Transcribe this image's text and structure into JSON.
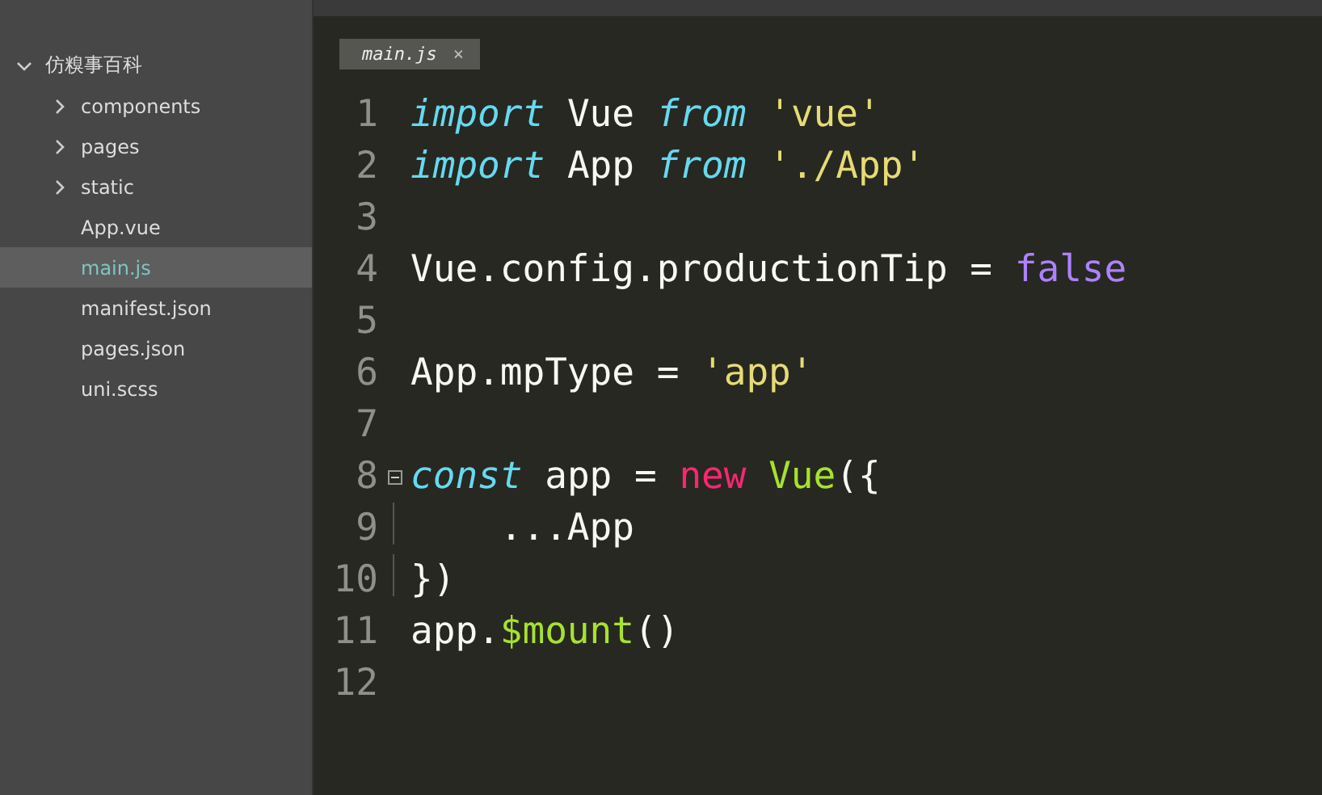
{
  "sidebar": {
    "tree": [
      {
        "label": "仿糗事百科",
        "kind": "folder",
        "expanded": true,
        "selected": false,
        "children": [
          {
            "label": "components",
            "kind": "folder",
            "expanded": false,
            "selected": false
          },
          {
            "label": "pages",
            "kind": "folder",
            "expanded": false,
            "selected": false
          },
          {
            "label": "static",
            "kind": "folder",
            "expanded": false,
            "selected": false
          },
          {
            "label": "App.vue",
            "kind": "file",
            "selected": false
          },
          {
            "label": "main.js",
            "kind": "file",
            "selected": true
          },
          {
            "label": "manifest.json",
            "kind": "file",
            "selected": false
          },
          {
            "label": "pages.json",
            "kind": "file",
            "selected": false
          },
          {
            "label": "uni.scss",
            "kind": "file",
            "selected": false
          }
        ]
      }
    ]
  },
  "tabs": [
    {
      "label": "main.js",
      "close": "×",
      "selected": true
    }
  ],
  "editor": {
    "lines": [
      {
        "number": "1",
        "tokens": [
          {
            "kind": "keyword",
            "text": "import"
          },
          {
            "kind": "plain",
            "text": " Vue "
          },
          {
            "kind": "keyword",
            "text": "from "
          },
          {
            "kind": "string",
            "text": "'vue'"
          }
        ]
      },
      {
        "number": "2",
        "tokens": [
          {
            "kind": "keyword",
            "text": "import"
          },
          {
            "kind": "plain",
            "text": " App "
          },
          {
            "kind": "keyword",
            "text": "from "
          },
          {
            "kind": "string",
            "text": "'./App'"
          }
        ]
      },
      {
        "number": "3"
      },
      {
        "number": "4",
        "tokens": [
          {
            "kind": "plain",
            "text": "Vue.config.productionTip = "
          },
          {
            "kind": "constant",
            "text": "false"
          }
        ]
      },
      {
        "number": "5"
      },
      {
        "number": "6",
        "tokens": [
          {
            "kind": "plain",
            "text": "App.mpType = "
          },
          {
            "kind": "string",
            "text": "'app'"
          }
        ]
      },
      {
        "number": "7"
      },
      {
        "number": "8",
        "folded": false,
        "tokens": [
          {
            "kind": "keyword",
            "text": "const"
          },
          {
            "kind": "plain",
            "text": " app = "
          },
          {
            "kind": "operator",
            "text": "new "
          },
          {
            "kind": "function",
            "text": "Vue"
          },
          {
            "kind": "plain",
            "text": "({"
          }
        ]
      },
      {
        "number": "9",
        "guide": true,
        "tokens": [
          {
            "kind": "plain",
            "text": "    ...App"
          }
        ]
      },
      {
        "number": "10",
        "guide": true,
        "tokens": [
          {
            "kind": "plain",
            "text": "})"
          }
        ]
      },
      {
        "number": "11",
        "tokens": [
          {
            "kind": "plain",
            "text": "app."
          },
          {
            "kind": "function",
            "text": "$mount"
          },
          {
            "kind": "plain",
            "text": "()"
          }
        ]
      },
      {
        "number": "12"
      }
    ]
  }
}
